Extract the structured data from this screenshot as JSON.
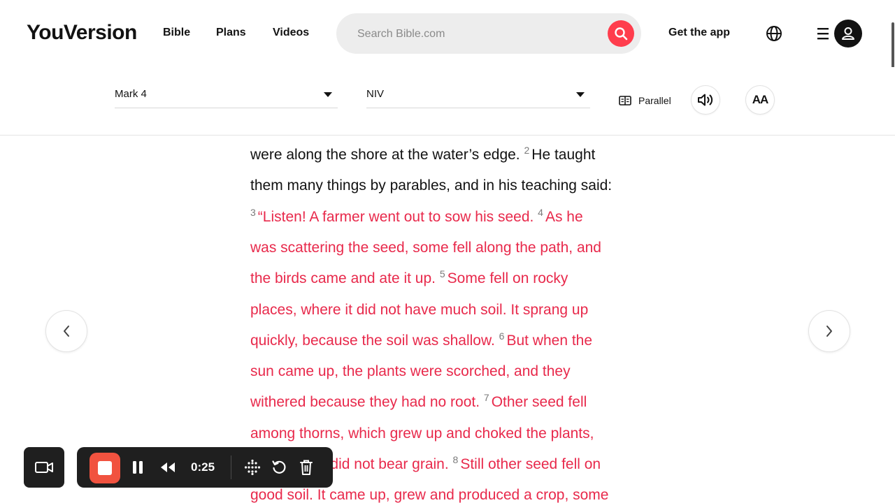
{
  "header": {
    "logo": "YouVersion",
    "nav": [
      "Bible",
      "Plans",
      "Videos"
    ],
    "search_placeholder": "Search Bible.com",
    "get_app": "Get the app"
  },
  "toolbar": {
    "book_chapter": "Mark 4",
    "version": "NIV",
    "parallel_label": "Parallel",
    "font_label": "AA"
  },
  "reader": {
    "lines": [
      {
        "num": "",
        "text": "were along the shore at the water’s edge.",
        "tail_num": "2",
        "tail": "He taught",
        "red": false,
        "tail_red": false
      },
      {
        "num": "",
        "text": "them many things by parables, and in his teaching said:",
        "tail_num": "",
        "tail": "",
        "red": false,
        "tail_red": false
      },
      {
        "num": "3",
        "text": "“Listen! A farmer went out to sow his seed.",
        "tail_num": "4",
        "tail": "As he",
        "red": true,
        "tail_red": true
      },
      {
        "num": "",
        "text": "was scattering the seed, some fell along the path, and",
        "tail_num": "",
        "tail": "",
        "red": true,
        "tail_red": true
      },
      {
        "num": "",
        "text": "the birds came and ate it up.",
        "tail_num": "5",
        "tail": "Some fell on rocky",
        "red": true,
        "tail_red": true
      },
      {
        "num": "",
        "text": "places, where it did not have much soil. It sprang up",
        "tail_num": "",
        "tail": "",
        "red": true,
        "tail_red": true
      },
      {
        "num": "",
        "text": "quickly, because the soil was shallow.",
        "tail_num": "6",
        "tail": "But when the",
        "red": true,
        "tail_red": true
      },
      {
        "num": "",
        "text": "sun came up, the plants were scorched, and they",
        "tail_num": "",
        "tail": "",
        "red": true,
        "tail_red": true
      },
      {
        "num": "",
        "text": "withered because they had no root.",
        "tail_num": "7",
        "tail": "Other seed fell",
        "red": true,
        "tail_red": true
      },
      {
        "num": "",
        "text": "among thorns, which grew up and choked the plants,",
        "tail_num": "",
        "tail": "",
        "red": true,
        "tail_red": true
      },
      {
        "num": "",
        "text": "so that they did not bear grain.",
        "tail_num": "8",
        "tail": "Still other seed fell on",
        "red": true,
        "tail_red": true
      },
      {
        "num": "",
        "text": "good soil. It came up, grew and produced a crop, some",
        "tail_num": "",
        "tail": "",
        "red": true,
        "tail_red": true
      }
    ]
  },
  "recorder": {
    "time": "0:25"
  },
  "colors": {
    "accent": "#e8294b",
    "search_button": "#ff3d4d",
    "record_stop": "#f1523f",
    "recorder_bg": "#1f1f1f"
  },
  "icons": [
    "search-icon",
    "globe-icon",
    "menu-icon",
    "user-icon",
    "parallel-icon",
    "audio-icon",
    "chevron-left-icon",
    "chevron-right-icon",
    "camera-icon",
    "stop-icon",
    "pause-icon",
    "rewind-icon",
    "grid-dots-icon",
    "restart-icon",
    "trash-icon"
  ]
}
